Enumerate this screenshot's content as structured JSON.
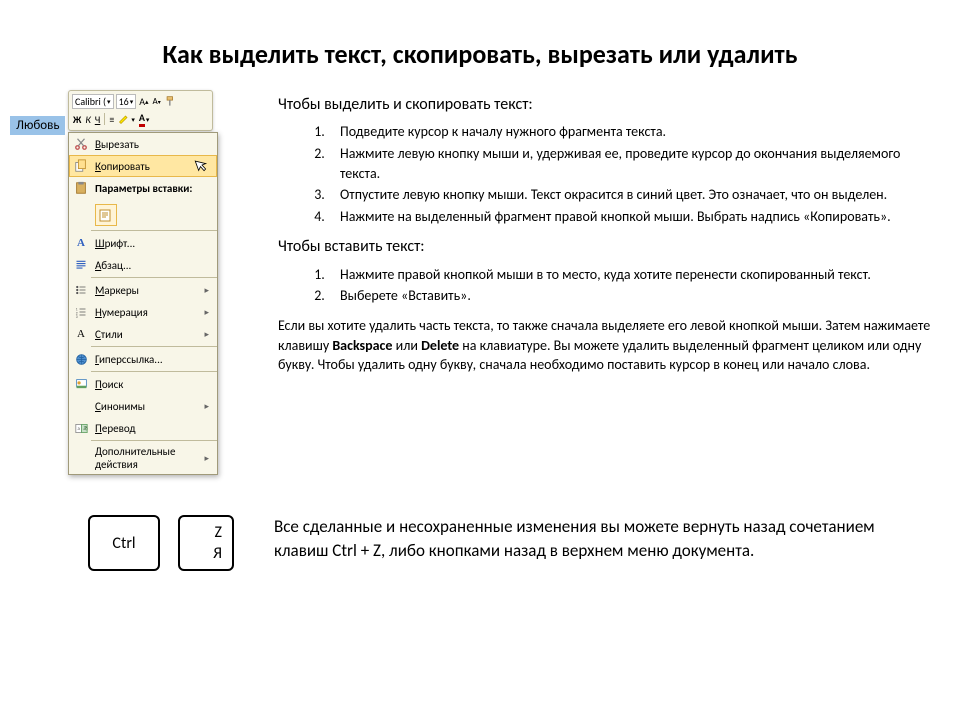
{
  "title": "Как выделить текст, скопировать, вырезать или удалить",
  "selected_word": "Любовь",
  "mini_toolbar": {
    "font_name": "Calibri (",
    "font_size": "16",
    "increase": "A˄",
    "decrease": "A˅",
    "bold": "Ж",
    "italic": "К",
    "underline": "Ч",
    "align": "≡",
    "highlight": "ab",
    "fontcolor": "A"
  },
  "context_menu": {
    "cut": "Вырезать",
    "copy": "Копировать",
    "paste_params": "Параметры вставки:",
    "font": "Шрифт...",
    "paragraph": "Абзац...",
    "bullets": "Маркеры",
    "numbering": "Нумерация",
    "styles": "Стили",
    "hyperlink": "Гиперссылка...",
    "search": "Поиск",
    "synonyms": "Синонимы",
    "translate": "Перевод",
    "additional": "Дополнительные действия"
  },
  "section1": {
    "heading": "Чтобы выделить и скопировать текст:",
    "steps": [
      "Подведите курсор к началу нужного фрагмента текста.",
      "Нажмите левую кнопку мыши и, удерживая ее, проведите курсор до окончания выделяемого текста.",
      "Отпустите левую кнопку мыши. Текст окрасится в синий цвет. Это означает, что он выделен.",
      "Нажмите на выделенный фрагмент правой кнопкой мыши. Выбрать надпись «Копировать»."
    ]
  },
  "section2": {
    "heading": "Чтобы вставить текст:",
    "steps": [
      "Нажмите правой кнопкой мыши в то место, куда хотите перенести скопированный текст.",
      "Выберете «Вставить»."
    ]
  },
  "delete_para_1": "Если вы хотите удалить часть текста, то также сначала выделяете его левой кнопкой мыши. Затем нажимаете клавишу ",
  "delete_para_b1": "Backspace",
  "delete_para_2": " или ",
  "delete_para_b2": "Delete",
  "delete_para_3": " на клавиатуре. Вы можете удалить выделенный фрагмент целиком или одну букву. Чтобы удалить одну букву, сначала необходимо поставить курсор в конец или начало слова.",
  "keys": {
    "ctrl": "Ctrl",
    "z_top": "Z",
    "z_bot": "Я"
  },
  "tip": "Все сделанные и несохраненные изменения вы можете вернуть назад сочетанием клавиш Ctrl + Z, либо кнопками назад в верхнем меню документа."
}
